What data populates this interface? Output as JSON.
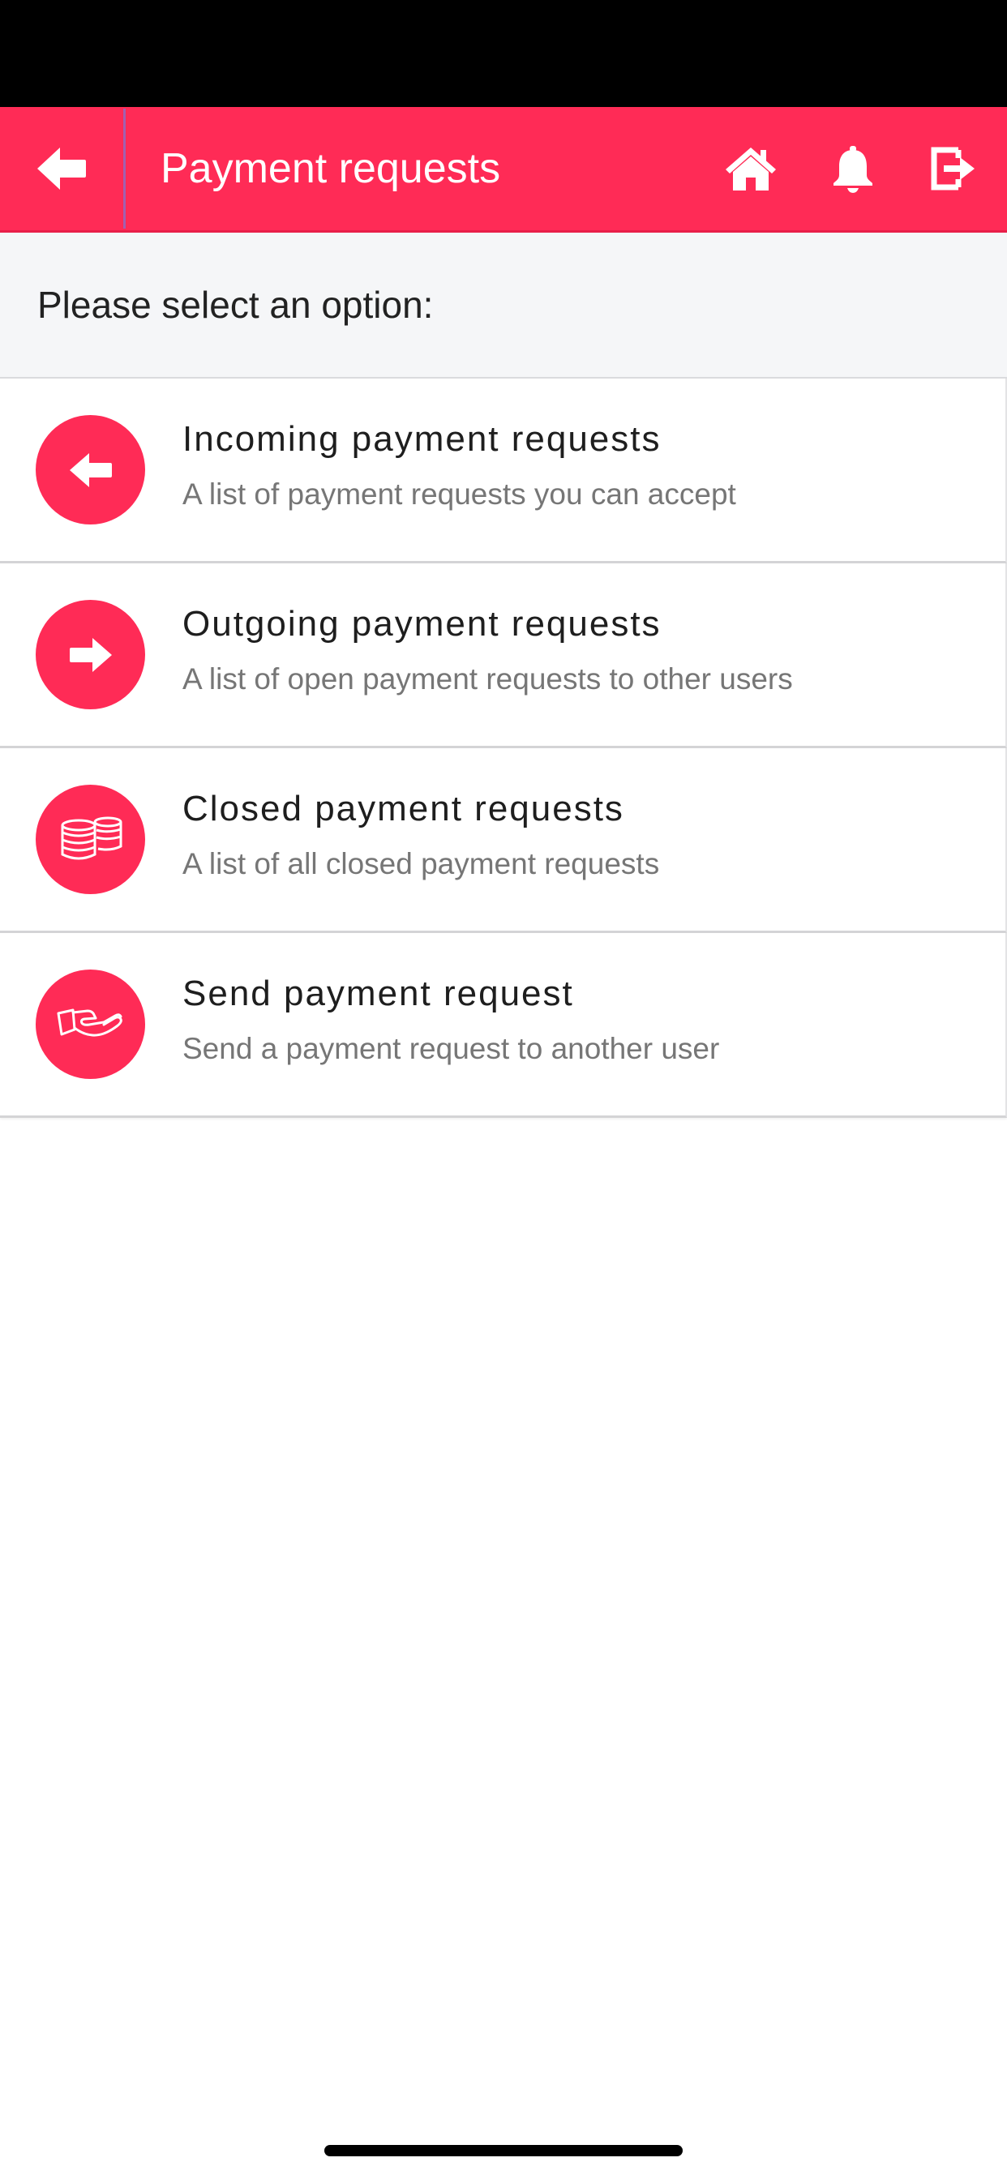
{
  "header": {
    "title": "Payment requests",
    "background_color": "#ff2b56",
    "icons": [
      "arrow-left-icon",
      "home-icon",
      "bell-icon",
      "logout-icon"
    ]
  },
  "prompt": "Please select an option:",
  "options": [
    {
      "title": "Incoming payment requests",
      "subtitle": "A list of payment requests you can accept",
      "icon": "arrow-left-icon"
    },
    {
      "title": "Outgoing payment requests",
      "subtitle": "A list of open payment requests to other users",
      "icon": "arrow-right-icon"
    },
    {
      "title": "Closed payment requests",
      "subtitle": "A list of all closed payment requests",
      "icon": "coin-stack-icon"
    },
    {
      "title": "Send payment request",
      "subtitle": "Send a payment request to another user",
      "icon": "hand-icon"
    }
  ]
}
